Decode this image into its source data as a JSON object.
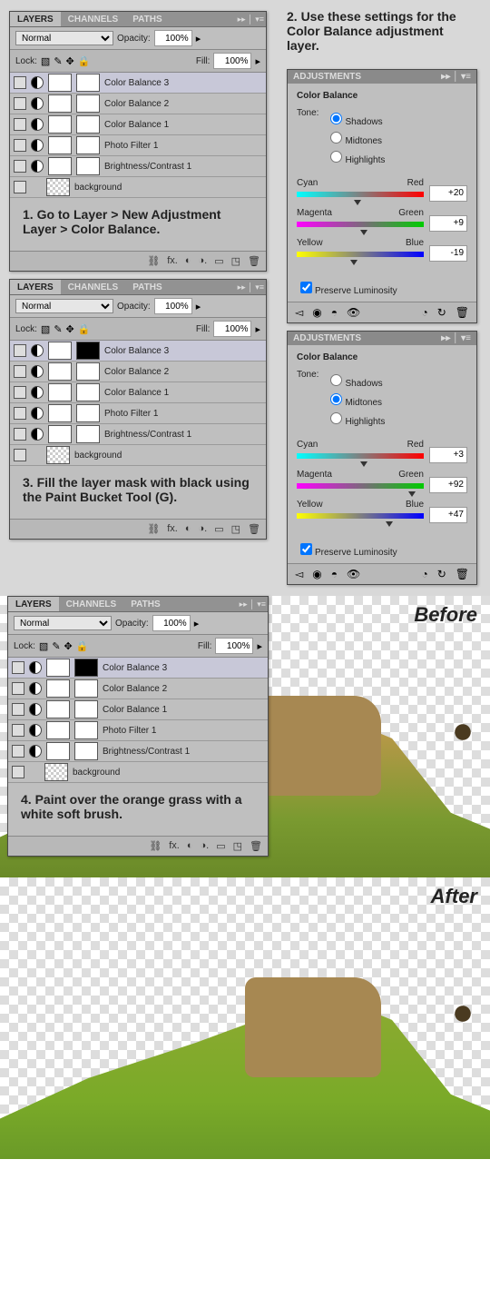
{
  "steps": {
    "s1": "1. Go to Layer > New Adjustment Layer > Color Balance.",
    "s2": "2. Use these settings for the Color Balance adjustment layer.",
    "s3": "3. Fill the layer mask with black using the Paint Bucket Tool (G).",
    "s4": "4. Paint over the orange grass with a white soft brush."
  },
  "layers_panel": {
    "tabs": [
      "LAYERS",
      "CHANNELS",
      "PATHS"
    ],
    "blend": "Normal",
    "opacity_lbl": "Opacity:",
    "opacity": "100%",
    "lock_lbl": "Lock:",
    "fill_lbl": "Fill:",
    "fill": "100%",
    "layers": [
      {
        "name": "Color Balance 3",
        "selected": true
      },
      {
        "name": "Color Balance 2"
      },
      {
        "name": "Color Balance 1"
      },
      {
        "name": "Photo Filter 1"
      },
      {
        "name": "Brightness/Contrast 1"
      },
      {
        "name": "background",
        "bg": true
      }
    ]
  },
  "layers_panel3": {
    "layers": [
      {
        "name": "Color Balance 3",
        "selected": true,
        "mask": "black"
      },
      {
        "name": "Color Balance 2"
      },
      {
        "name": "Color Balance 1"
      },
      {
        "name": "Photo Filter 1"
      },
      {
        "name": "Brightness/Contrast 1"
      },
      {
        "name": "background",
        "bg": true
      }
    ]
  },
  "layers_panel4": {
    "layers": [
      {
        "name": "Color Balance 3",
        "selected": true,
        "mask": "painted"
      },
      {
        "name": "Color Balance 2"
      },
      {
        "name": "Color Balance 1"
      },
      {
        "name": "Photo Filter 1"
      },
      {
        "name": "Brightness/Contrast 1"
      },
      {
        "name": "background",
        "bg": true
      }
    ]
  },
  "adjustments": {
    "tab": "ADJUSTMENTS",
    "title": "Color Balance",
    "tone_lbl": "Tone:",
    "tones": [
      "Shadows",
      "Midtones",
      "Highlights"
    ],
    "preserve": "Preserve Luminosity",
    "sliders": [
      {
        "l": "Cyan",
        "r": "Red"
      },
      {
        "l": "Magenta",
        "r": "Green"
      },
      {
        "l": "Yellow",
        "r": "Blue"
      }
    ],
    "p1": {
      "selected": "Shadows",
      "values": [
        "+20",
        "+9",
        "-19"
      ]
    },
    "p2": {
      "selected": "Midtones",
      "values": [
        "+3",
        "+92",
        "+47"
      ]
    }
  },
  "labels": {
    "before": "Before",
    "after": "After"
  }
}
